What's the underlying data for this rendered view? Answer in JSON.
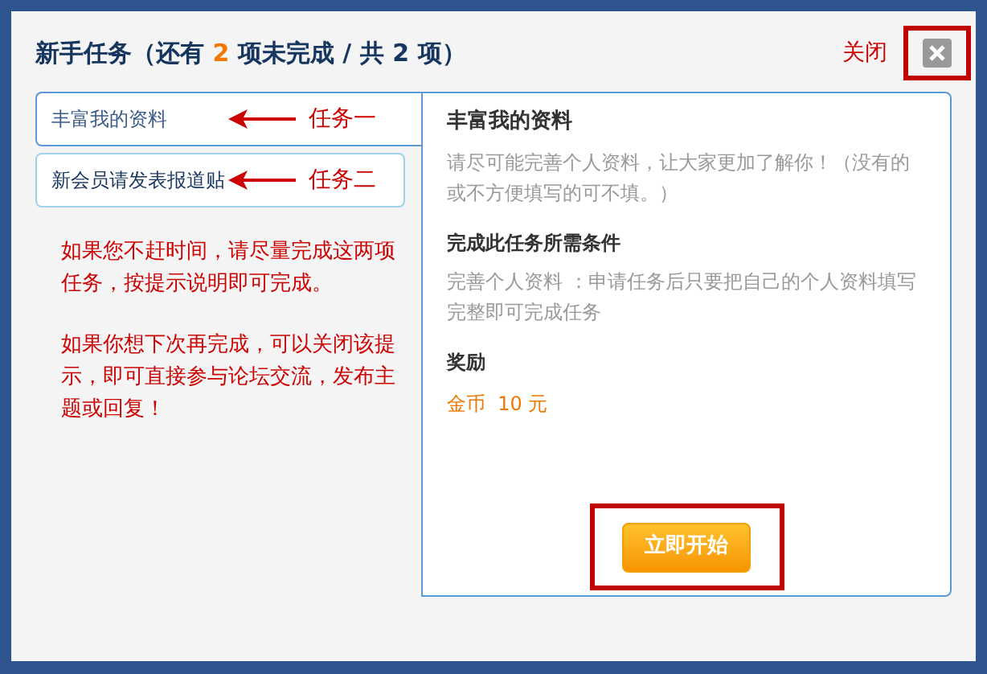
{
  "dialog": {
    "title": {
      "prefix": "新手任务（还有",
      "pending": "2",
      "middle": "项未完成 / 共",
      "total": "2",
      "suffix": "项）"
    },
    "close_label": "关闭",
    "close_highlighted": true
  },
  "tasks": [
    {
      "label": "丰富我的资料",
      "selected": true,
      "annotation": "任务一"
    },
    {
      "label": "新会员请发表报道贴",
      "selected": false,
      "annotation": "任务二"
    }
  ],
  "notes": [
    "如果您不赶时间，请尽量完成这两项任务，按提示说明即可完成。",
    "如果你想下次再完成，可以关闭该提示，即可直接参与论坛交流，发布主题或回复！"
  ],
  "detail": {
    "title": "丰富我的资料",
    "description": "请尽可能完善个人资料，让大家更加了解你！（没有的或不方便填写的可不填。）",
    "conditions_heading": "完成此任务所需条件",
    "conditions": "完善个人资料 ：申请任务后只要把自己的个人资料填写完整即可完成任务",
    "reward_heading": "奖励",
    "reward": "金币  10 元",
    "start_button": "立即开始",
    "start_highlighted": true
  }
}
